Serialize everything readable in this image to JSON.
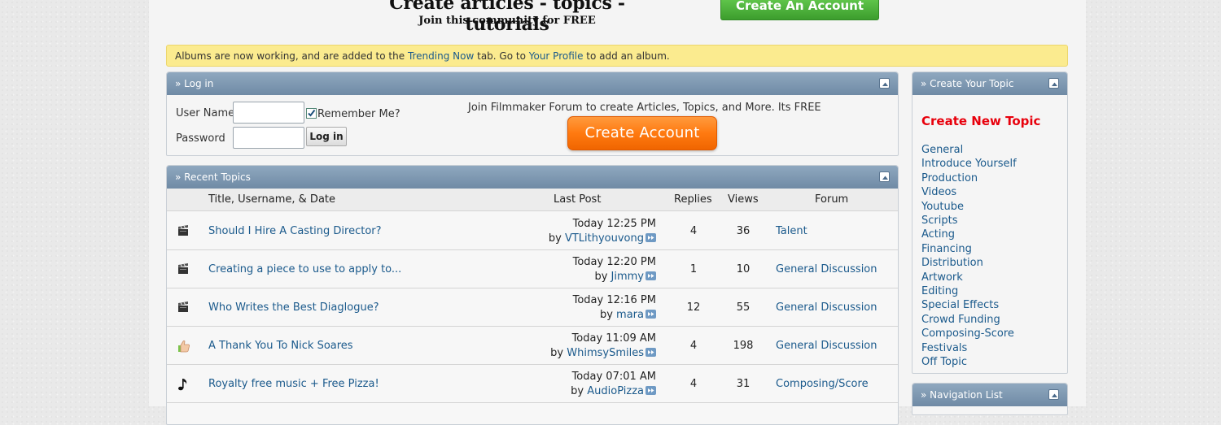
{
  "header": {
    "title": "Create articles - topics - tutorials",
    "subtitle": "Join this community for FREE",
    "cta_label": "Create An Account"
  },
  "notice": {
    "text_1": "Albums are now working, and are added to the ",
    "link_1": "Trending Now",
    "text_2": " tab. Go to ",
    "link_2": "Your Profile",
    "text_3": " to add an album."
  },
  "login": {
    "title": "» Log in",
    "username_label": "User Name",
    "password_label": "Password",
    "username_value": "",
    "password_value": "",
    "remember_label": "Remember Me?",
    "remember_checked": true,
    "login_button": "Log in",
    "join_text": "Join Filmmaker Forum to create Articles, Topics, and More. Its FREE",
    "create_account": "Create Account"
  },
  "recent_topics": {
    "title": "» Recent Topics",
    "columns": {
      "title": "Title, Username, & Date",
      "last_post": "Last Post",
      "replies": "Replies",
      "views": "Views",
      "forum": "Forum"
    },
    "rows": [
      {
        "icon": "clapperboard-icon",
        "title": "Should I Hire A Casting Director?",
        "date": "Today 12:25 PM",
        "by": "by",
        "user": "VTLithyouvong",
        "replies": "4",
        "views": "36",
        "forum": "Talent"
      },
      {
        "icon": "clapperboard-icon",
        "title": "Creating a piece to use to apply to...",
        "date": "Today 12:20 PM",
        "by": "by",
        "user": "Jimmy",
        "replies": "1",
        "views": "10",
        "forum": "General Discussion"
      },
      {
        "icon": "clapperboard-icon",
        "title": "Who Writes the Best Diaglogue?",
        "date": "Today 12:16 PM",
        "by": "by",
        "user": "mara",
        "replies": "12",
        "views": "55",
        "forum": "General Discussion"
      },
      {
        "icon": "thumbs-up-icon",
        "title": "A Thank You To Nick Soares",
        "date": "Today 11:09 AM",
        "by": "by",
        "user": "WhimsySmiles",
        "replies": "4",
        "views": "198",
        "forum": "General Discussion"
      },
      {
        "icon": "music-note-icon",
        "title": "Royalty free music + Free Pizza!",
        "date": "Today 07:01 AM",
        "by": "by",
        "user": "AudioPizza",
        "replies": "4",
        "views": "31",
        "forum": "Composing/Score"
      }
    ]
  },
  "sidebar": {
    "create_title": "» Create Your Topic",
    "create_new": "Create New Topic",
    "topics": [
      "General",
      "Introduce Yourself",
      "Production",
      "Videos",
      "Youtube",
      "Scripts",
      "Acting",
      "Financing",
      "Distribution",
      "Artwork",
      "Editing",
      "Special Effects",
      "Crowd Funding",
      "Composing-Score",
      "Festivals",
      "Off Topic"
    ],
    "nav_title": "» Navigation List"
  },
  "colors": {
    "header_blue": "#7e98b1",
    "link": "#1b5a8c",
    "create_new_red": "#e8000c",
    "orange_button": "#ff7a10",
    "notice_yellow": "#fbeb8f",
    "green_cta": "#4cb23a"
  }
}
